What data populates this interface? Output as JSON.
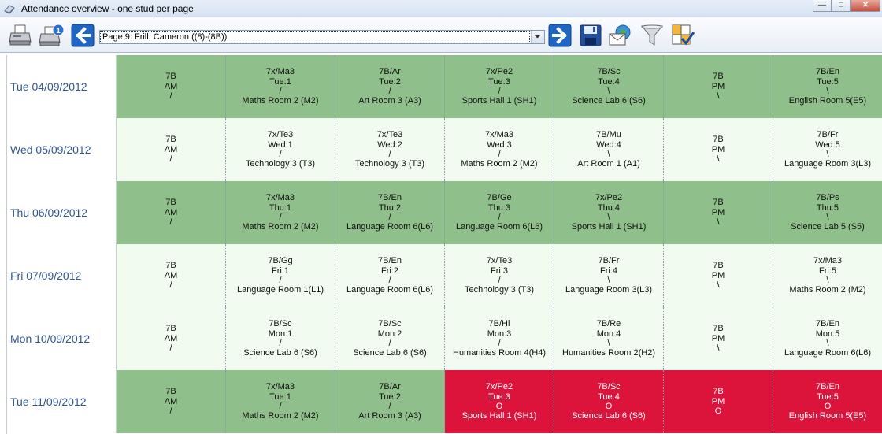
{
  "window": {
    "title": "Attendance overview - one stud per page"
  },
  "toolbar": {
    "page_selector": "Page 9: Frill, Cameron ((8)-(8B))",
    "icons": [
      "print-icon",
      "print-one-icon",
      "previous-page-icon",
      "next-page-icon",
      "save-icon",
      "email-icon",
      "filter-icon",
      "checklist-icon"
    ]
  },
  "colors": {
    "present_row": "#8fbf8a",
    "alt_row": "#f1fbef",
    "absent": "#dc143c",
    "date_text": "#2e5593"
  },
  "rows": [
    {
      "date": "Tue 04/09/2012",
      "style": "green",
      "cells": [
        {
          "lines": [
            "7B",
            "AM",
            "/"
          ]
        },
        {
          "lines": [
            "7x/Ma3",
            "Tue:1",
            "/",
            "Maths Room 2 (M2)"
          ]
        },
        {
          "lines": [
            "7B/Ar",
            "Tue:2",
            "/",
            "Art Room 3 (A3)"
          ]
        },
        {
          "lines": [
            "7x/Pe2",
            "Tue:3",
            "/",
            "Sports Hall 1 (SH1)"
          ]
        },
        {
          "lines": [
            "7B/Sc",
            "Tue:4",
            "\\",
            "Science Lab 6 (S6)"
          ]
        },
        {
          "lines": [
            "7B",
            "PM",
            "\\"
          ]
        },
        {
          "lines": [
            "7B/En",
            "Tue:5",
            "\\",
            "English Room 5(E5)"
          ]
        }
      ]
    },
    {
      "date": "Wed 05/09/2012",
      "style": "alt",
      "cells": [
        {
          "lines": [
            "7B",
            "AM",
            "/"
          ]
        },
        {
          "lines": [
            "7x/Te3",
            "Wed:1",
            "/",
            "Technology 3 (T3)"
          ]
        },
        {
          "lines": [
            "7x/Te3",
            "Wed:2",
            "/",
            "Technology 3 (T3)"
          ]
        },
        {
          "lines": [
            "7x/Ma3",
            "Wed:3",
            "/",
            "Maths Room 2 (M2)"
          ]
        },
        {
          "lines": [
            "7B/Mu",
            "Wed:4",
            "\\",
            "Art Room 1 (A1)"
          ]
        },
        {
          "lines": [
            "7B",
            "PM",
            "\\"
          ]
        },
        {
          "lines": [
            "7B/Fr",
            "Wed:5",
            "\\",
            "Language Room 3(L3)"
          ]
        }
      ]
    },
    {
      "date": "Thu 06/09/2012",
      "style": "green",
      "cells": [
        {
          "lines": [
            "7B",
            "AM",
            "/"
          ]
        },
        {
          "lines": [
            "7x/Ma3",
            "Thu:1",
            "/",
            "Maths Room 2 (M2)"
          ]
        },
        {
          "lines": [
            "7B/En",
            "Thu:2",
            "/",
            "Language Room 6(L6)"
          ]
        },
        {
          "lines": [
            "7B/Ge",
            "Thu:3",
            "/",
            "Language Room 6(L6)"
          ]
        },
        {
          "lines": [
            "7x/Pe2",
            "Thu:4",
            "\\",
            "Sports Hall 1 (SH1)"
          ]
        },
        {
          "lines": [
            "7B",
            "PM",
            "\\"
          ]
        },
        {
          "lines": [
            "7B/Ps",
            "Thu:5",
            "\\",
            "Science Lab 5 (S5)"
          ]
        }
      ]
    },
    {
      "date": "Fri 07/09/2012",
      "style": "alt",
      "cells": [
        {
          "lines": [
            "7B",
            "AM",
            "/"
          ]
        },
        {
          "lines": [
            "7B/Gg",
            "Fri:1",
            "/",
            "Language Room 1(L1)"
          ]
        },
        {
          "lines": [
            "7B/En",
            "Fri:2",
            "/",
            "Language Room 6(L6)"
          ]
        },
        {
          "lines": [
            "7x/Te3",
            "Fri:3",
            "/",
            "Technology 3 (T3)"
          ]
        },
        {
          "lines": [
            "7B/Fr",
            "Fri:4",
            "\\",
            "Language Room 3(L3)"
          ]
        },
        {
          "lines": [
            "7B",
            "PM",
            "\\"
          ]
        },
        {
          "lines": [
            "7x/Ma3",
            "Fri:5",
            "\\",
            "Maths Room 2 (M2)"
          ]
        }
      ]
    },
    {
      "date": "Mon 10/09/2012",
      "style": "alt",
      "cells": [
        {
          "lines": [
            "7B",
            "AM",
            "/"
          ]
        },
        {
          "lines": [
            "7B/Sc",
            "Mon:1",
            "/",
            "Science Lab 6 (S6)"
          ]
        },
        {
          "lines": [
            "7B/Sc",
            "Mon:2",
            "/",
            "Science Lab 6 (S6)"
          ]
        },
        {
          "lines": [
            "7B/Hi",
            "Mon:3",
            "/",
            "Humanities Room 4(H4)"
          ]
        },
        {
          "lines": [
            "7B/Re",
            "Mon:4",
            "\\",
            "Humanities Room 2(H2)"
          ]
        },
        {
          "lines": [
            "7B",
            "PM",
            "\\"
          ]
        },
        {
          "lines": [
            "7B/En",
            "Mon:5",
            "\\",
            "Language Room 6(L6)"
          ]
        }
      ]
    },
    {
      "date": "Tue 11/09/2012",
      "style": "green",
      "cells": [
        {
          "lines": [
            "7B",
            "AM",
            "/"
          ]
        },
        {
          "lines": [
            "7x/Ma3",
            "Tue:1",
            "/",
            "Maths Room 2 (M2)"
          ]
        },
        {
          "lines": [
            "7B/Ar",
            "Tue:2",
            "/",
            "Art Room 3 (A3)"
          ]
        },
        {
          "lines": [
            "7x/Pe2",
            "Tue:3",
            "O",
            "Sports Hall 1 (SH1)"
          ],
          "absent": true
        },
        {
          "lines": [
            "7B/Sc",
            "Tue:4",
            "O",
            "Science Lab 6 (S6)"
          ],
          "absent": true
        },
        {
          "lines": [
            "7B",
            "PM",
            "O"
          ],
          "absent": true
        },
        {
          "lines": [
            "7B/En",
            "Tue:5",
            "O",
            "English Room 5(E5)"
          ],
          "absent": true
        }
      ]
    }
  ]
}
